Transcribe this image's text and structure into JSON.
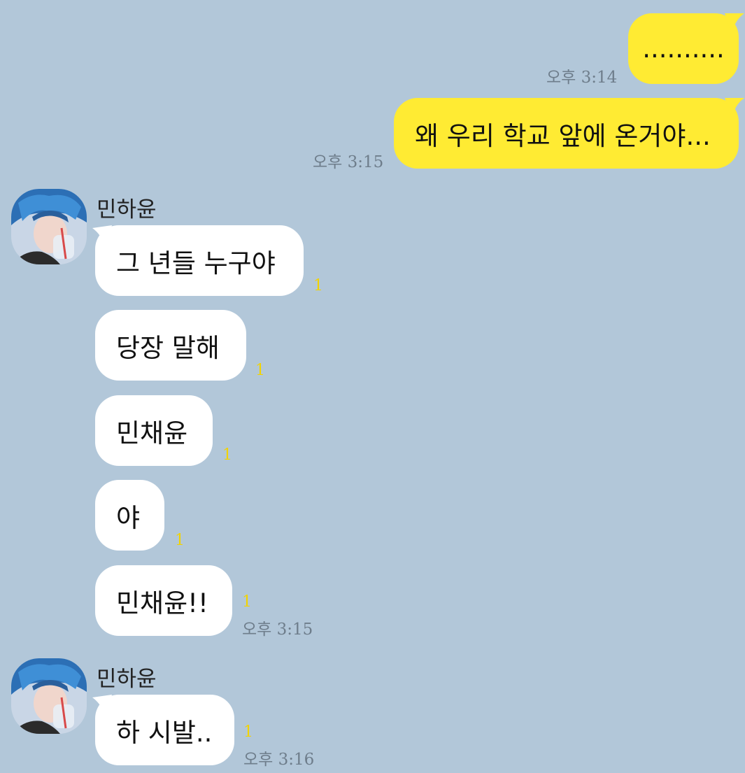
{
  "colors": {
    "background": "#b2c7d9",
    "my_bubble": "#ffeb33",
    "their_bubble": "#ffffff",
    "unread": "#f2d300",
    "timestamp": "#6e7d8b"
  },
  "sent": [
    {
      "text": "..........",
      "time": "오후 3:14"
    },
    {
      "text": "왜 우리 학교 앞에 온거야...",
      "time": "오후 3:15"
    }
  ],
  "group1": {
    "sender": "민하윤",
    "avatar_icon": "profile-photo-icon",
    "messages": [
      {
        "text": "그 년들 누구야",
        "unread": "1"
      },
      {
        "text": "당장 말해",
        "unread": "1"
      },
      {
        "text": "민채윤",
        "unread": "1"
      },
      {
        "text": "야",
        "unread": "1"
      },
      {
        "text": "민채윤!!",
        "unread": "1",
        "time": "오후 3:15"
      }
    ]
  },
  "group2": {
    "sender": "민하윤",
    "avatar_icon": "profile-photo-icon",
    "messages": [
      {
        "text": "하 시발..",
        "unread": "1",
        "time": "오후 3:16"
      }
    ]
  }
}
